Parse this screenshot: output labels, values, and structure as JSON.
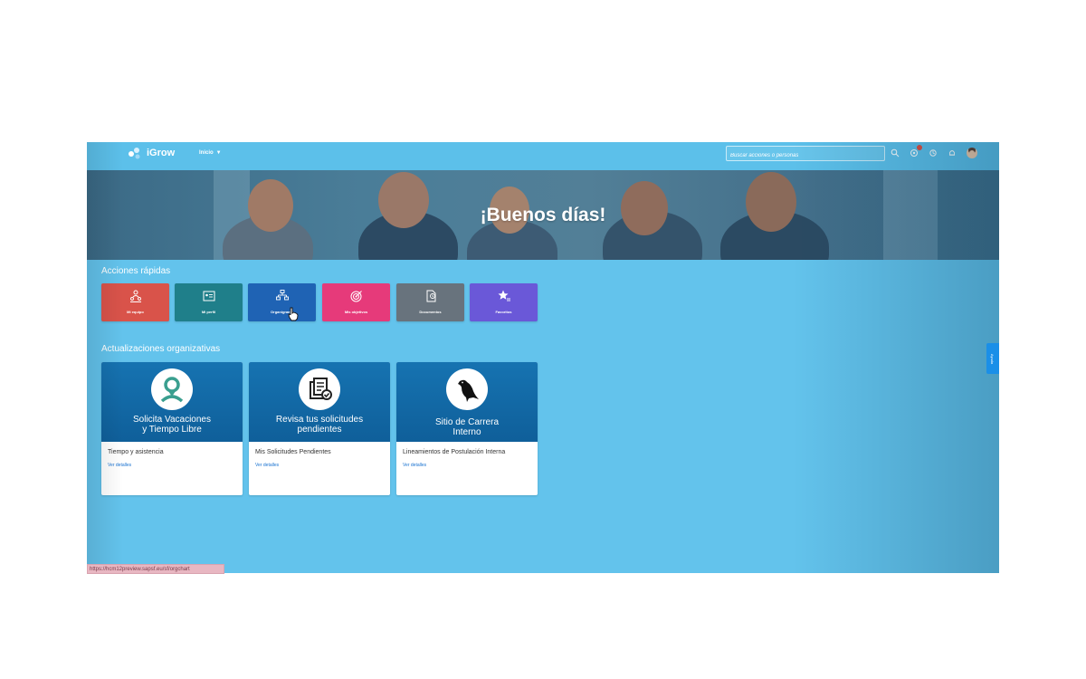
{
  "topbar": {
    "app_name": "iGrow",
    "nav_home_label": "Inicio",
    "search_placeholder": "Buscar acciones o personas",
    "icons": [
      "search-icon",
      "notifications-icon",
      "settings-icon",
      "bell-icon",
      "user-avatar"
    ]
  },
  "hero": {
    "greeting": "¡Buenos días!"
  },
  "quick_actions": {
    "title": "Acciones rápidas",
    "items": [
      {
        "label": "Mi equipo",
        "icon": "team-icon",
        "color": "#d9534a"
      },
      {
        "label": "Mi perfil",
        "icon": "profile-card-icon",
        "color": "#1f7f8a"
      },
      {
        "label": "Organigrama",
        "icon": "org-chart-icon",
        "color": "#1f63b4"
      },
      {
        "label": "Mis objetivos",
        "icon": "target-icon",
        "color": "#e63a7a"
      },
      {
        "label": "Documentos",
        "icon": "document-clock-icon",
        "color": "#68737d"
      },
      {
        "label": "Favoritos",
        "icon": "star-list-icon",
        "color": "#6a58d8"
      }
    ]
  },
  "org_updates": {
    "title": "Actualizaciones organizativas",
    "cards": [
      {
        "banner_line1": "Solicita Vacaciones",
        "banner_line2": "y Tiempo Libre",
        "description": "Tiempo y asistencia",
        "link": "Ver detalles",
        "icon": "person-icon"
      },
      {
        "banner_line1": "Revisa tus solicitudes",
        "banner_line2": "pendientes",
        "description": "Mis Solicitudes Pendientes",
        "link": "Ver detalles",
        "icon": "documents-check-icon"
      },
      {
        "banner_line1": "Sitio de Carrera",
        "banner_line2": "Interno",
        "description": "Lineamientos de Postulación Interna",
        "link": "Ver detalles",
        "icon": "raven-icon"
      }
    ]
  },
  "side_tab": {
    "label": "Ayuda"
  },
  "status_bar": {
    "url": "https://hcm12preview.sapsf.eu/sf/orgchart"
  },
  "colors": {
    "app_background": "#63c3ec",
    "card_banner": "#1673b1",
    "link": "#1a73d1"
  }
}
